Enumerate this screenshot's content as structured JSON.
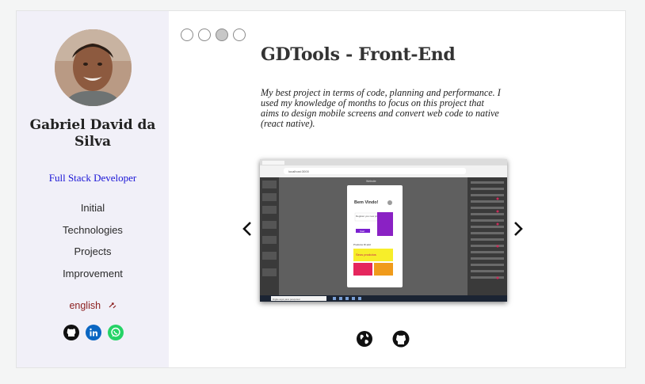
{
  "profile": {
    "name": "Gabriel David da Silva",
    "role": "Full Stack Developer"
  },
  "nav": {
    "items": [
      {
        "label": "Initial"
      },
      {
        "label": "Technologies"
      },
      {
        "label": "Projects"
      },
      {
        "label": "Improvement"
      }
    ]
  },
  "language": {
    "label": "english",
    "icon": "translate-icon"
  },
  "socials": [
    {
      "icon": "github-icon",
      "color": "#111111"
    },
    {
      "icon": "linkedin-icon",
      "color": "#0a66c2"
    },
    {
      "icon": "whatsapp-icon",
      "color": "#25d366"
    }
  ],
  "project": {
    "title": "GDTools - Front-End",
    "description": "My best project in terms of code, planning and performance. I used my knowledge of months to focus on this project that aims to design mobile screens and convert web code to native (react native).",
    "carousel_pages": 4,
    "active_page": 3,
    "screenshot": {
      "address": "localhost:3000",
      "header": "Website",
      "welcome": "Bem Vindo!",
      "tagline": "Register you new products",
      "button": "Start",
      "section": "Produtos ID add",
      "highlight": "Seus produtos",
      "search": "Digite aqui para pesquisar"
    },
    "links": [
      {
        "icon": "globe-icon"
      },
      {
        "icon": "github-icon"
      }
    ]
  },
  "colors": {
    "sidebar_bg": "#f1f0f8",
    "role": "#1a15d6",
    "language": "#8b1d1d"
  }
}
